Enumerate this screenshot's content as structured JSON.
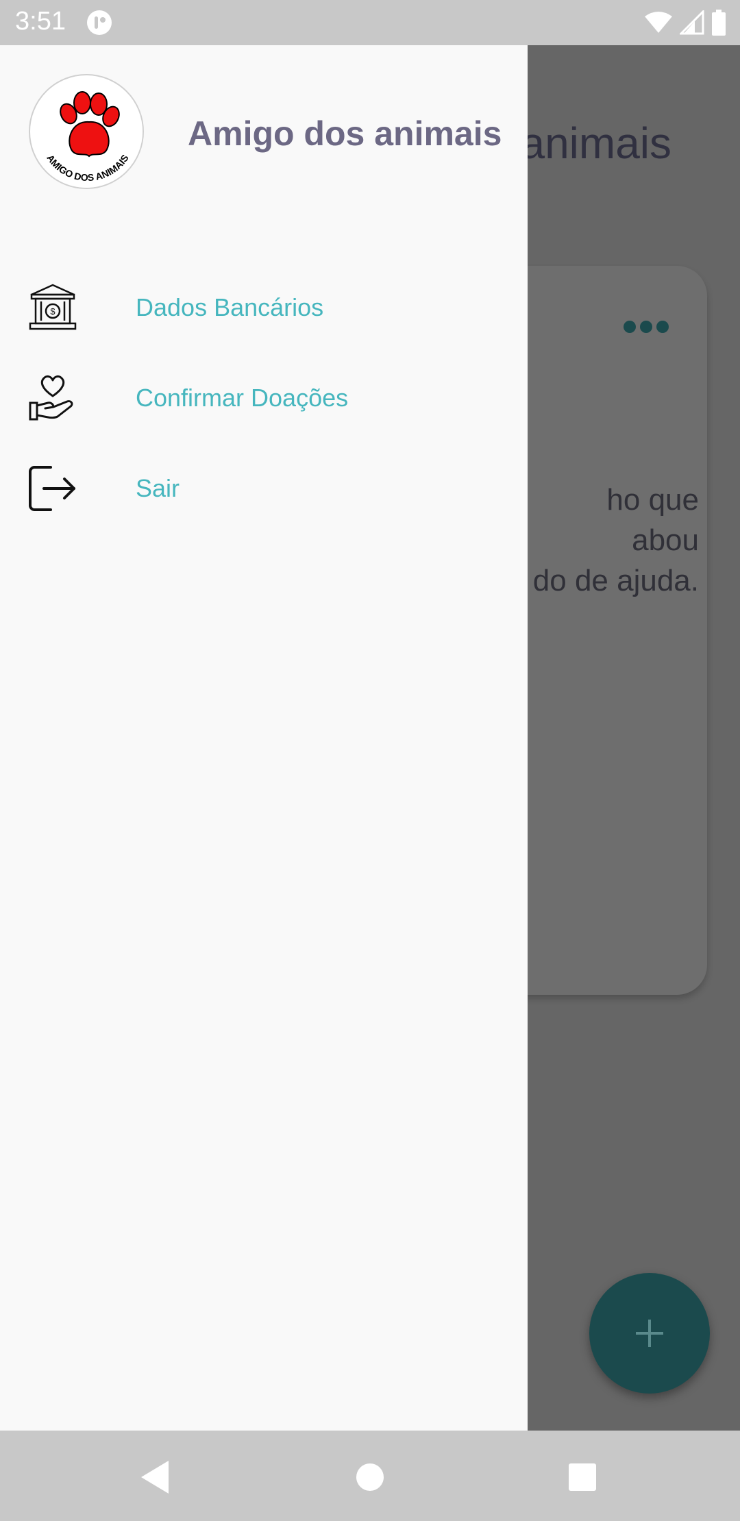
{
  "status_bar": {
    "time": "3:51",
    "icons": [
      "app-notification-icon",
      "wifi-icon",
      "signal-icon",
      "battery-icon"
    ]
  },
  "background": {
    "title_fragment": "animais",
    "description_fragment": "ho que\nabou\ndo de ajuda.",
    "fab_icon": "plus-icon",
    "more_icon": "more-horizontal-icon"
  },
  "drawer": {
    "title": "Amigo dos animais",
    "logo_text": "AMIGO DOS ANIMAIS",
    "logo_icon": "paw-icon",
    "items": [
      {
        "label": "Dados Bancários",
        "icon": "bank-icon"
      },
      {
        "label": "Confirmar Doações",
        "icon": "heart-hand-icon"
      },
      {
        "label": "Sair",
        "icon": "logout-icon"
      }
    ]
  },
  "nav_bar": {
    "buttons": [
      "back-icon",
      "home-icon",
      "recents-icon"
    ]
  },
  "colors": {
    "accent": "#46b6be",
    "drawer_title": "#6c6884",
    "drawer_bg": "#f9f9f9",
    "fab": "#1b4a4d",
    "paw": "#ee1111"
  }
}
